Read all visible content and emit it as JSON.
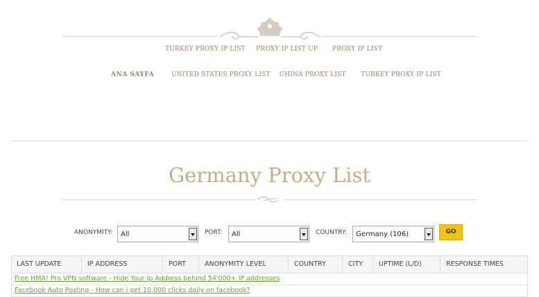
{
  "top_nav": {
    "row1": [
      "TURKEY PROXY IP LIST",
      "PROXY IP LIST UP",
      "PROXY IP LIST"
    ],
    "row2": [
      "ANA SAYFA",
      "UNITED STATES PROXY LIST",
      "CHINA PROXY LIST",
      "TURKEY PROXY IP LIST"
    ]
  },
  "page": {
    "title": "Germany Proxy List"
  },
  "filters": {
    "anonymity_label": "ANONYMITY:",
    "anonymity_value": "All",
    "port_label": "PORT:",
    "port_value": "All",
    "country_label": "COUNTRY:",
    "country_value": "Germany (106)",
    "go_label": "GO"
  },
  "table": {
    "columns": [
      "LAST UPDATE",
      "IP ADDRESS",
      "PORT",
      "ANONYMITY LEVEL",
      "COUNTRY",
      "CITY",
      "UPTIME (L/D)",
      "RESPONSE TIMES"
    ],
    "ad_rows": [
      "Free HMA! Pro VPN software - Hide Your Ip Address behind 54'000+ IP addresses",
      "Facebook Auto Posting - How can i get 10.000 clicks daily on facebook?"
    ]
  },
  "colors": {
    "accent_gold": "#c4ad87",
    "go_button": "#f2c40e",
    "link_green": "#6aa532"
  }
}
